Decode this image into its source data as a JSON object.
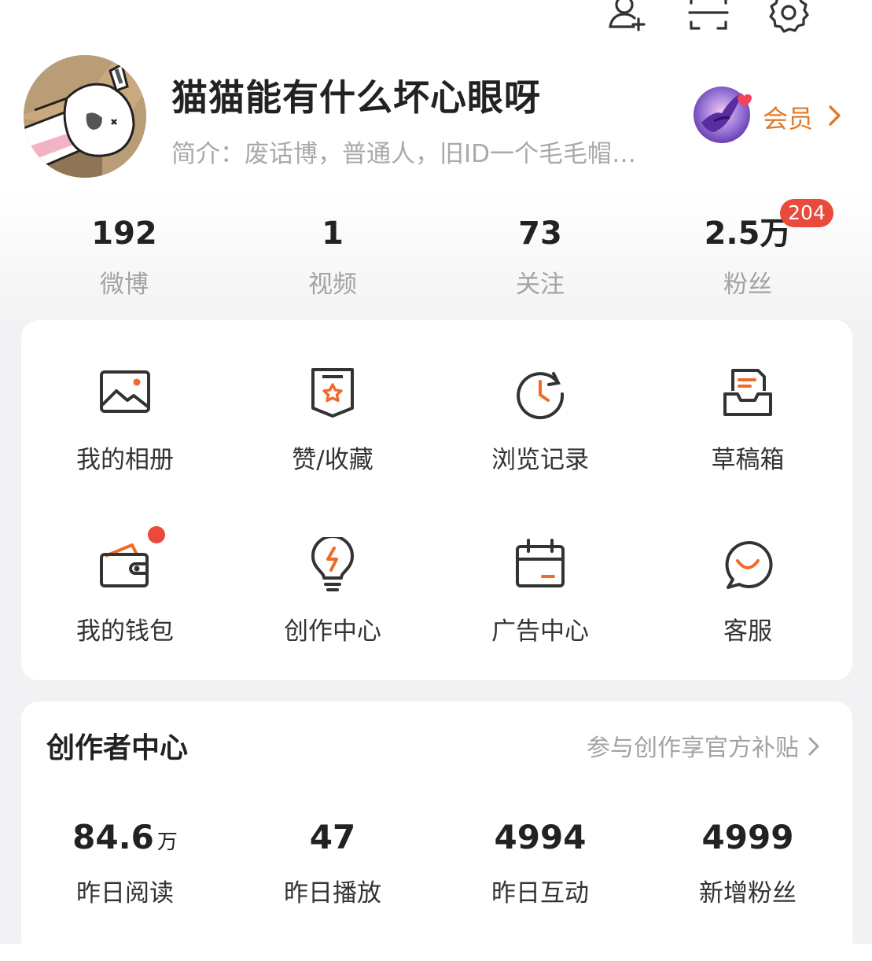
{
  "top_bar": {
    "icons": [
      "add-friend-icon",
      "scan-icon",
      "settings-icon"
    ]
  },
  "profile": {
    "nickname": "猫猫能有什么坏心眼呀",
    "bio": "简介：废话博，普通人，旧ID一个毛毛帽…",
    "vip_label": "会员"
  },
  "stats": [
    {
      "value": "192",
      "label": "微博"
    },
    {
      "value": "1",
      "label": "视频"
    },
    {
      "value": "73",
      "label": "关注"
    },
    {
      "value": "2.5万",
      "label": "粉丝",
      "badge": "204"
    }
  ],
  "grid": [
    {
      "label": "我的相册",
      "icon": "album-icon"
    },
    {
      "label": "赞/收藏",
      "icon": "favorites-icon"
    },
    {
      "label": "浏览记录",
      "icon": "history-icon"
    },
    {
      "label": "草稿箱",
      "icon": "drafts-icon"
    },
    {
      "label": "我的钱包",
      "icon": "wallet-icon",
      "dot": true
    },
    {
      "label": "创作中心",
      "icon": "lightbulb-icon"
    },
    {
      "label": "广告中心",
      "icon": "calendar-icon"
    },
    {
      "label": "客服",
      "icon": "chat-icon"
    }
  ],
  "creator": {
    "title": "创作者中心",
    "link": "参与创作享官方补贴",
    "metrics": [
      {
        "value": "84.6",
        "unit": "万",
        "label": "昨日阅读"
      },
      {
        "value": "47",
        "unit": "",
        "label": "昨日播放"
      },
      {
        "value": "4994",
        "unit": "",
        "label": "昨日互动"
      },
      {
        "value": "4999",
        "unit": "",
        "label": "新增粉丝"
      }
    ]
  },
  "colors": {
    "accent": "#f06a2a",
    "badge_red": "#e94a3c",
    "vip_text": "#e07a2a",
    "icon_dark": "#333333"
  }
}
